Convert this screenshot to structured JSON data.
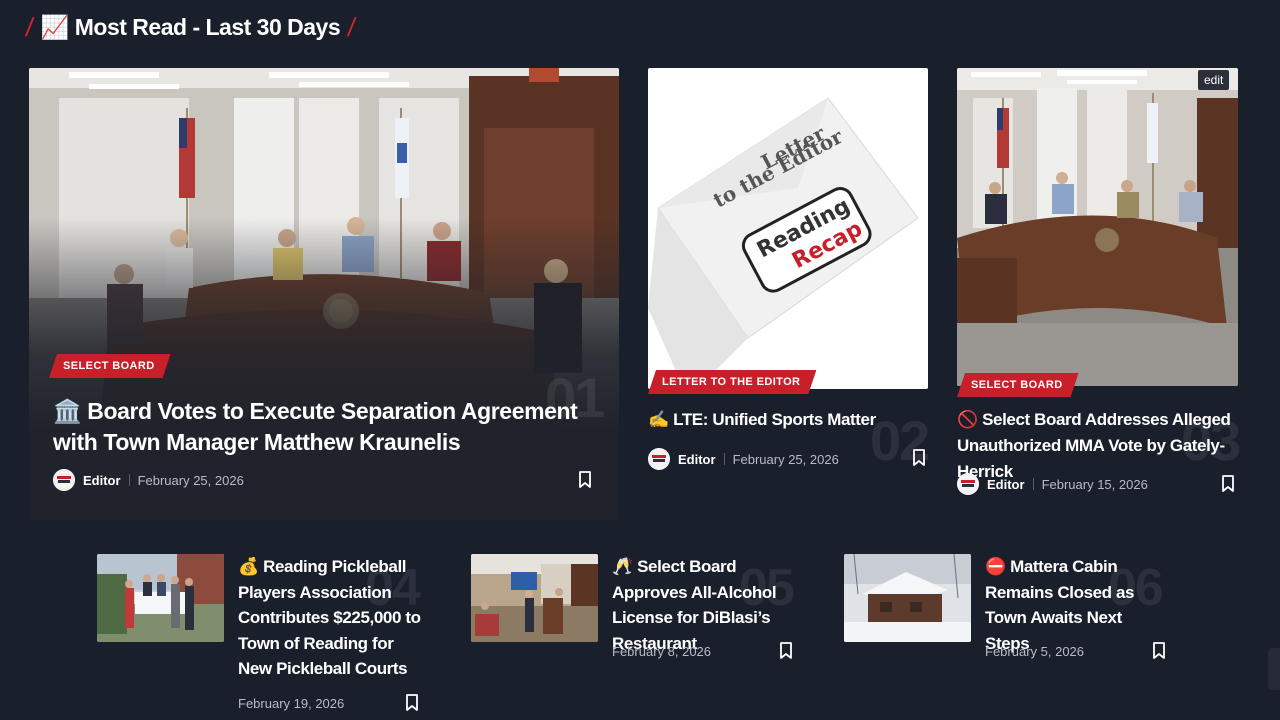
{
  "section": {
    "title": "📈 Most Read - Last 30 Days"
  },
  "featured": {
    "category": "SELECT BOARD",
    "title": "🏛️ Board Votes to Execute Separation Agreement with Town Manager Matthew Kraunelis",
    "author": "Editor",
    "date": "February 25, 2026",
    "rank": "01"
  },
  "cards": [
    {
      "category": "LETTER TO THE EDITOR",
      "title": "✍️ LTE: Unified Sports Matter",
      "author": "Editor",
      "date": "February 25, 2026",
      "rank": "02",
      "image_text": {
        "line1": "Letter",
        "line2": "to the Editor",
        "logo1": "Reading",
        "logo2": "Recap"
      }
    },
    {
      "category": "SELECT BOARD",
      "title": "🚫 Select Board Addresses Alleged Unauthorized MMA Vote by Gately-Herrick",
      "author": "Editor",
      "date": "February 15, 2026",
      "rank": "03",
      "edit_label": "edit"
    }
  ],
  "small_cards": [
    {
      "title": "💰 Reading Pickleball Players Association Contributes $225,000 to Town of Reading for New Pickleball Courts",
      "date": "February 19, 2026",
      "rank": "04"
    },
    {
      "title": "🥂 Select Board Approves All-Alcohol License for DiBlasi’s Restaurant",
      "date": "February 8, 2026",
      "rank": "05"
    },
    {
      "title": "⛔ Mattera Cabin Remains Closed as Town Awaits Next Steps",
      "date": "February 5, 2026",
      "rank": "06"
    }
  ],
  "colors": {
    "background": "#1a1f2c",
    "accent": "#c8202a",
    "card": "#20232c"
  }
}
